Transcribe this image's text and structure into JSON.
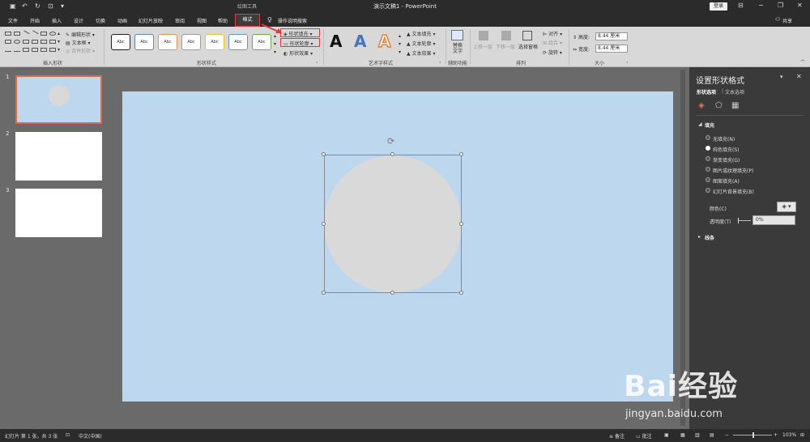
{
  "window": {
    "title": "演示文稿1 - PowerPoint",
    "context_group": "绘图工具",
    "login": "登录",
    "share": "共享"
  },
  "tabs": [
    "文件",
    "开始",
    "插入",
    "设计",
    "切换",
    "动画",
    "幻灯片放映",
    "审阅",
    "视图",
    "帮助"
  ],
  "active_tab": "格式",
  "search_label": "操作说明搜索",
  "ribbon": {
    "insert_shapes": {
      "label": "插入形状",
      "edit_shape": "编辑形状",
      "text_box": "文本框",
      "merge_shapes": "合并形状"
    },
    "shape_styles": {
      "label": "形状样式",
      "sample_text": "Abc",
      "fill": "形状填充",
      "outline": "形状轮廓",
      "effect": "形状效果"
    },
    "wordart": {
      "label": "艺术字样式",
      "letter": "A",
      "text_fill": "文本填充",
      "text_outline": "文本轮廓",
      "text_effect": "文本效果"
    },
    "accessibility": {
      "label": "辅助功能",
      "alt_text": "替换文字"
    },
    "arrange": {
      "label": "排列",
      "bring_forward": "上移一层",
      "send_backward": "下移一层",
      "selection_pane": "选择窗格",
      "align": "对齐",
      "group": "组合",
      "rotate": "旋转"
    },
    "size": {
      "label": "大小",
      "height_label": "高度:",
      "height_value": "8.44 厘米",
      "width_label": "宽度:",
      "width_value": "8.44 厘米"
    }
  },
  "slides": [
    "1",
    "2",
    "3"
  ],
  "pane": {
    "title": "设置形状格式",
    "tab_shape": "形状选项",
    "tab_text": "文本选项",
    "section_fill": "填充",
    "options": [
      "无填充(N)",
      "纯色填充(S)",
      "渐变填充(G)",
      "图片或纹理填充(P)",
      "图案填充(A)",
      "幻灯片背景填充(B)"
    ],
    "selected_option": 1,
    "color_label": "颜色(C)",
    "transparency_label": "透明度(T)",
    "transparency_value": "0%",
    "section_line": "线条"
  },
  "status": {
    "slide_info": "幻灯片 第 1 张，共 3 张",
    "language": "中文(中国)",
    "notes": "备注",
    "comments": "批注",
    "zoom": "103%"
  },
  "watermark": {
    "brand": "Bai经验",
    "url": "jingyan.baidu.com"
  },
  "colors": {
    "slide_bg": "#bdd7ee",
    "circle_fill": "#d9d9d9",
    "highlight": "#e03a3a",
    "titlebar": "#2b2b2b"
  }
}
